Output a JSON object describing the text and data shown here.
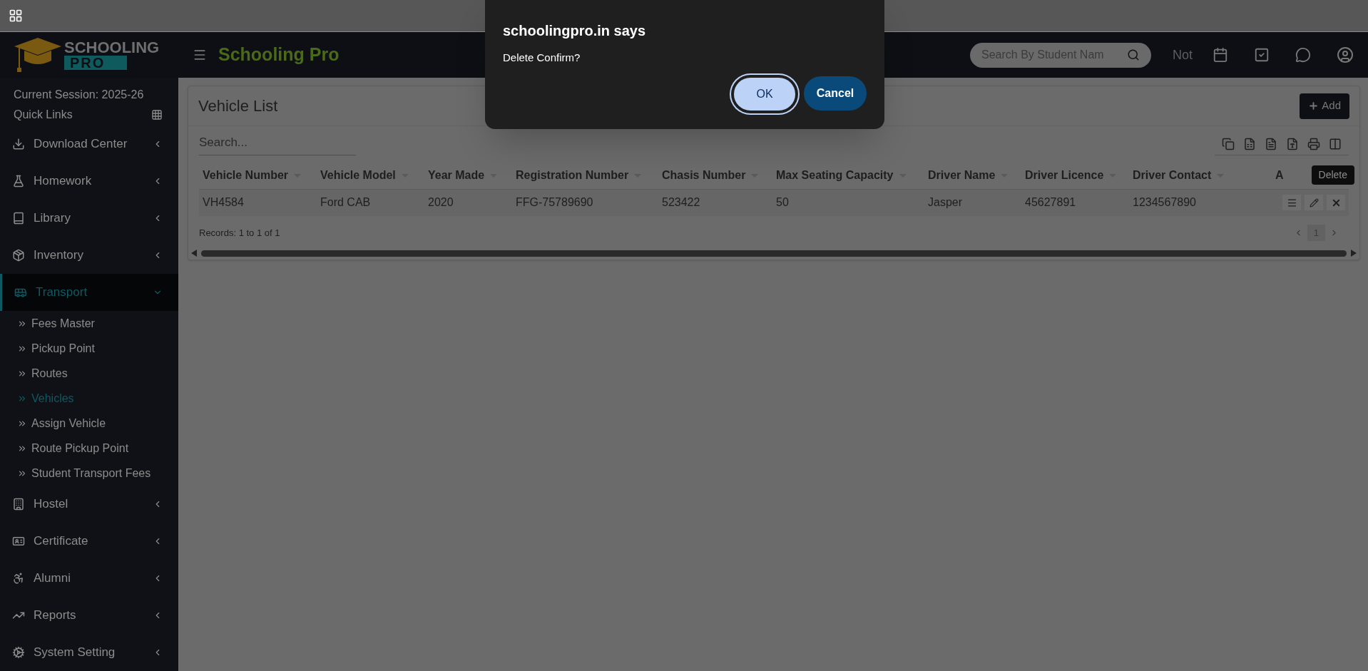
{
  "logo": {
    "line1": "SCHOOLING",
    "line2": "PRO"
  },
  "header": {
    "title": "Schooling Pro",
    "search_placeholder": "Search By Student Nam",
    "cut_text": "Not"
  },
  "sidebar": {
    "session": "Current Session: 2025-26",
    "quick_links": "Quick Links",
    "items": [
      {
        "label": "Download Center",
        "kind": "download",
        "expanded": false,
        "selected": false
      },
      {
        "label": "Homework",
        "kind": "flask",
        "expanded": false,
        "selected": false
      },
      {
        "label": "Library",
        "kind": "book",
        "expanded": false,
        "selected": false
      },
      {
        "label": "Inventory",
        "kind": "inventory",
        "expanded": false,
        "selected": false
      },
      {
        "label": "Transport",
        "kind": "bus",
        "expanded": true,
        "selected": true,
        "children": [
          {
            "label": "Fees Master",
            "selected": false
          },
          {
            "label": "Pickup Point",
            "selected": false
          },
          {
            "label": "Routes",
            "selected": false
          },
          {
            "label": "Vehicles",
            "selected": true
          },
          {
            "label": "Assign Vehicle",
            "selected": false
          },
          {
            "label": "Route Pickup Point",
            "selected": false
          },
          {
            "label": "Student Transport Fees",
            "selected": false
          }
        ]
      },
      {
        "label": "Hostel",
        "kind": "building",
        "expanded": false,
        "selected": false
      },
      {
        "label": "Certificate",
        "kind": "certificate",
        "expanded": false,
        "selected": false
      },
      {
        "label": "Alumni",
        "kind": "alumni",
        "expanded": false,
        "selected": false
      },
      {
        "label": "Reports",
        "kind": "chart",
        "expanded": false,
        "selected": false
      },
      {
        "label": "System Setting",
        "kind": "settings",
        "expanded": false,
        "selected": false
      }
    ]
  },
  "card": {
    "title": "Vehicle List",
    "add_button": "Add",
    "search_placeholder": "Search...",
    "columns": [
      "Vehicle Number",
      "Vehicle Model",
      "Year Made",
      "Registration Number",
      "Chasis Number",
      "Max Seating Capacity",
      "Driver Name",
      "Driver Licence",
      "Driver Contact",
      "A"
    ],
    "rows": [
      [
        "VH4584",
        "Ford CAB",
        "2020",
        "FFG-75789690",
        "523422",
        "50",
        "Jasper",
        "45627891",
        "1234567890"
      ]
    ],
    "records": "Records: 1 to 1 of 1",
    "page": "1",
    "tooltip": "Delete"
  },
  "dialog": {
    "title": "schoolingpro.in says",
    "message": "Delete Confirm?",
    "buttons": [
      {
        "label": "OK",
        "kind": "primary"
      },
      {
        "label": "Cancel",
        "kind": "secondary"
      }
    ]
  }
}
